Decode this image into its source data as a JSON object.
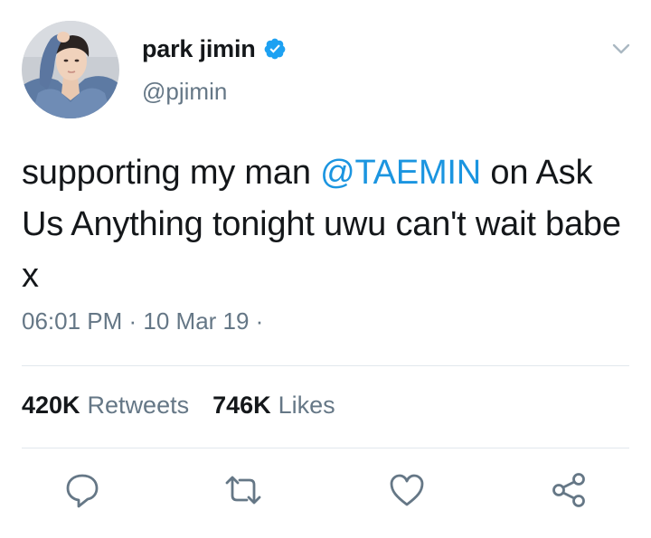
{
  "user": {
    "display_name": "park jimin",
    "handle": "@pjimin",
    "verified": true
  },
  "tweet": {
    "text_before": "supporting my man ",
    "mention": "@TAEMIN",
    "text_after": " on Ask Us Anything tonight uwu can't wait babe x",
    "timestamp": "06:01 PM · 10 Mar 19 ·"
  },
  "stats": {
    "retweets_count": "420K",
    "retweets_label": "Retweets",
    "likes_count": "746K",
    "likes_label": "Likes"
  },
  "colors": {
    "accent": "#1b95e0",
    "verified": "#1da1f2",
    "icon_gray": "#657786"
  },
  "icons": {
    "reply": "reply-icon",
    "retweet": "retweet-icon",
    "like": "heart-icon",
    "share": "share-icon",
    "menu": "chevron-down-icon"
  }
}
